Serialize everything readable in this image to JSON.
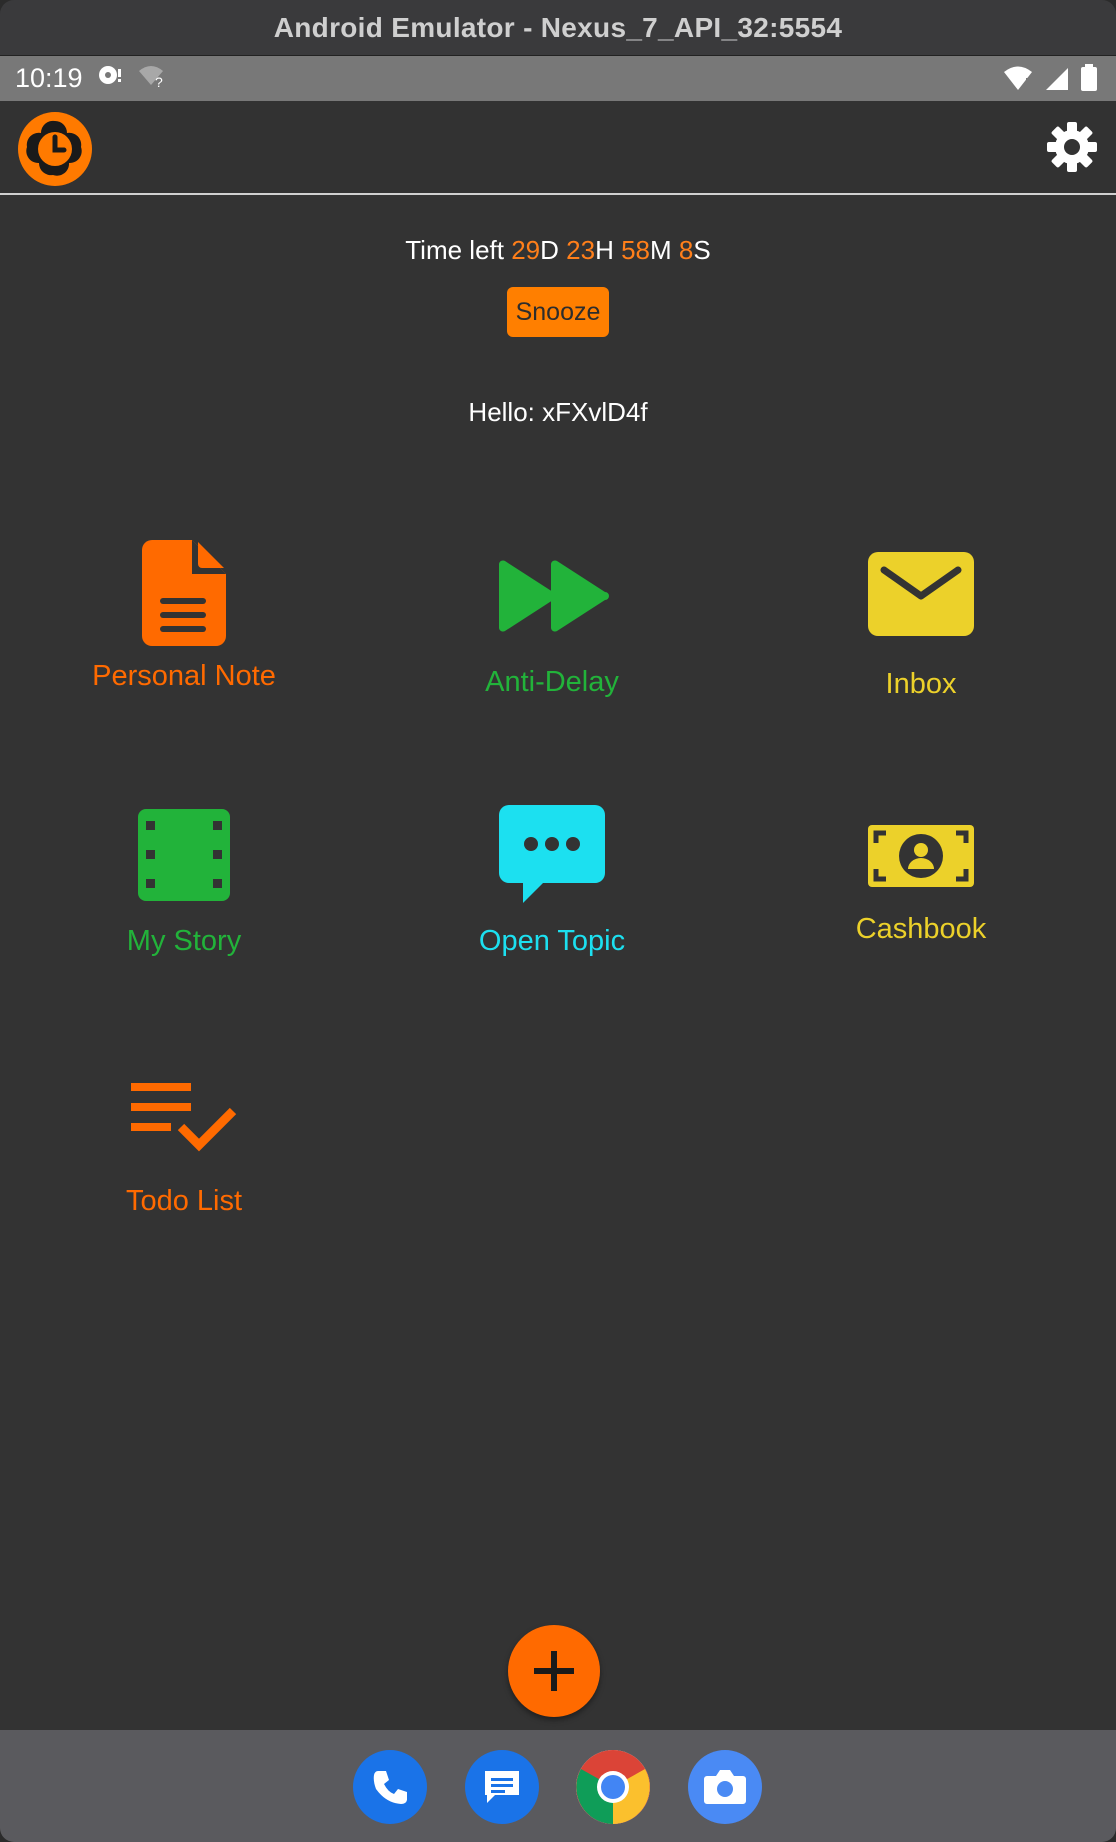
{
  "window": {
    "title": "Android Emulator - Nexus_7_API_32:5554"
  },
  "status_bar": {
    "time": "10:19"
  },
  "timer": {
    "prefix": "Time left",
    "days": "29",
    "days_unit": "D",
    "hours": "23",
    "hours_unit": "H",
    "minutes": "58",
    "minutes_unit": "M",
    "seconds": "8",
    "seconds_unit": "S"
  },
  "snooze_label": "Snooze",
  "greeting": "Hello: xFXvlD4f",
  "tiles": {
    "personal_note": "Personal Note",
    "anti_delay": "Anti-Delay",
    "inbox": "Inbox",
    "my_story": "My Story",
    "open_topic": "Open Topic",
    "cashbook": "Cashbook",
    "todo_list": "Todo List"
  },
  "colors": {
    "orange": "#ff6a00",
    "green": "#22b33a",
    "yellow": "#ecd12a",
    "cyan": "#1ce0f0",
    "background": "#333333"
  },
  "icons": {
    "personal_note": "document-icon",
    "anti_delay": "fast-forward-icon",
    "inbox": "envelope-icon",
    "my_story": "film-icon",
    "open_topic": "chat-bubble-icon",
    "cashbook": "cash-icon",
    "todo_list": "checklist-icon",
    "settings": "gear-icon",
    "fab": "plus-icon"
  },
  "dock": [
    "phone-icon",
    "messages-icon",
    "chrome-icon",
    "camera-icon"
  ]
}
